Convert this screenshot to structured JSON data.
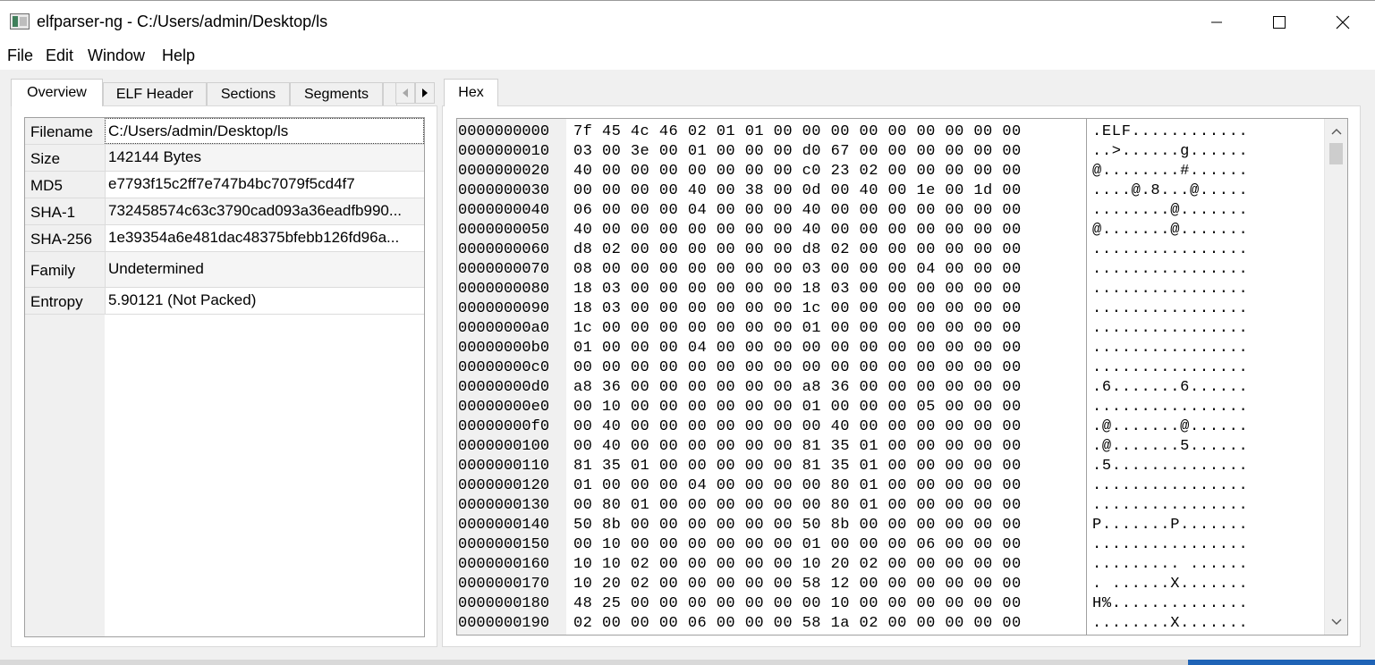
{
  "window": {
    "title": "elfparser-ng - C:/Users/admin/Desktop/ls",
    "icon": "app-icon",
    "controls": [
      "minimize-icon",
      "maximize-icon",
      "close-icon"
    ]
  },
  "menu": [
    "File",
    "Edit",
    "Window",
    "Help"
  ],
  "left_tabs": [
    "Overview",
    "ELF Header",
    "Sections",
    "Segments"
  ],
  "overview": {
    "rows": [
      {
        "name": "Filename",
        "value": "C:/Users/admin/Desktop/ls"
      },
      {
        "name": "Size",
        "value": "142144 Bytes"
      },
      {
        "name": "MD5",
        "value": "e7793f15c2ff7e747b4bc7079f5cd4f7"
      },
      {
        "name": "SHA-1",
        "value": "732458574c63c3790cad093a36eadfb990..."
      },
      {
        "name": "SHA-256",
        "value": "1e39354a6e481dac48375bfebb126fd96a..."
      },
      {
        "name": "Family",
        "value": "Undetermined"
      },
      {
        "name": "Entropy",
        "value": "5.90121 (Not Packed)"
      }
    ]
  },
  "right_tabs": [
    "Hex"
  ],
  "hex": {
    "rows": [
      {
        "offset": "0000000000",
        "bytes": "7f 45 4c 46 02 01 01 00 00 00 00 00 00 00 00 00",
        "ascii": ".ELF............"
      },
      {
        "offset": "0000000010",
        "bytes": "03 00 3e 00 01 00 00 00 d0 67 00 00 00 00 00 00",
        "ascii": "..>......g......"
      },
      {
        "offset": "0000000020",
        "bytes": "40 00 00 00 00 00 00 00 c0 23 02 00 00 00 00 00",
        "ascii": "@........#......"
      },
      {
        "offset": "0000000030",
        "bytes": "00 00 00 00 40 00 38 00 0d 00 40 00 1e 00 1d 00",
        "ascii": "....@.8...@....."
      },
      {
        "offset": "0000000040",
        "bytes": "06 00 00 00 04 00 00 00 40 00 00 00 00 00 00 00",
        "ascii": "........@......."
      },
      {
        "offset": "0000000050",
        "bytes": "40 00 00 00 00 00 00 00 40 00 00 00 00 00 00 00",
        "ascii": "@.......@......."
      },
      {
        "offset": "0000000060",
        "bytes": "d8 02 00 00 00 00 00 00 d8 02 00 00 00 00 00 00",
        "ascii": "................"
      },
      {
        "offset": "0000000070",
        "bytes": "08 00 00 00 00 00 00 00 03 00 00 00 04 00 00 00",
        "ascii": "................"
      },
      {
        "offset": "0000000080",
        "bytes": "18 03 00 00 00 00 00 00 18 03 00 00 00 00 00 00",
        "ascii": "................"
      },
      {
        "offset": "0000000090",
        "bytes": "18 03 00 00 00 00 00 00 1c 00 00 00 00 00 00 00",
        "ascii": "................"
      },
      {
        "offset": "00000000a0",
        "bytes": "1c 00 00 00 00 00 00 00 01 00 00 00 00 00 00 00",
        "ascii": "................"
      },
      {
        "offset": "00000000b0",
        "bytes": "01 00 00 00 04 00 00 00 00 00 00 00 00 00 00 00",
        "ascii": "................"
      },
      {
        "offset": "00000000c0",
        "bytes": "00 00 00 00 00 00 00 00 00 00 00 00 00 00 00 00",
        "ascii": "................"
      },
      {
        "offset": "00000000d0",
        "bytes": "a8 36 00 00 00 00 00 00 a8 36 00 00 00 00 00 00",
        "ascii": ".6.......6......"
      },
      {
        "offset": "00000000e0",
        "bytes": "00 10 00 00 00 00 00 00 01 00 00 00 05 00 00 00",
        "ascii": "................"
      },
      {
        "offset": "00000000f0",
        "bytes": "00 40 00 00 00 00 00 00 00 40 00 00 00 00 00 00",
        "ascii": ".@.......@......"
      },
      {
        "offset": "0000000100",
        "bytes": "00 40 00 00 00 00 00 00 81 35 01 00 00 00 00 00",
        "ascii": ".@.......5......"
      },
      {
        "offset": "0000000110",
        "bytes": "81 35 01 00 00 00 00 00 81 35 01 00 00 00 00 00",
        "ascii": ".5.............."
      },
      {
        "offset": "0000000120",
        "bytes": "01 00 00 00 04 00 00 00 00 80 01 00 00 00 00 00",
        "ascii": "................"
      },
      {
        "offset": "0000000130",
        "bytes": "00 80 01 00 00 00 00 00 00 80 01 00 00 00 00 00",
        "ascii": "................"
      },
      {
        "offset": "0000000140",
        "bytes": "50 8b 00 00 00 00 00 00 50 8b 00 00 00 00 00 00",
        "ascii": "P.......P......."
      },
      {
        "offset": "0000000150",
        "bytes": "00 10 00 00 00 00 00 00 01 00 00 00 06 00 00 00",
        "ascii": "................"
      },
      {
        "offset": "0000000160",
        "bytes": "10 10 02 00 00 00 00 00 10 20 02 00 00 00 00 00",
        "ascii": "......... ......"
      },
      {
        "offset": "0000000170",
        "bytes": "10 20 02 00 00 00 00 00 58 12 00 00 00 00 00 00",
        "ascii": ". ......X......."
      },
      {
        "offset": "0000000180",
        "bytes": "48 25 00 00 00 00 00 00 00 10 00 00 00 00 00 00",
        "ascii": "H%.............."
      },
      {
        "offset": "0000000190",
        "bytes": "02 00 00 00 06 00 00 00 58 1a 02 00 00 00 00 00",
        "ascii": "........X......."
      }
    ]
  },
  "colors": {
    "background": "#f0f0f0",
    "panel": "#ffffff",
    "taskbar_accent": "#1f63b6"
  }
}
